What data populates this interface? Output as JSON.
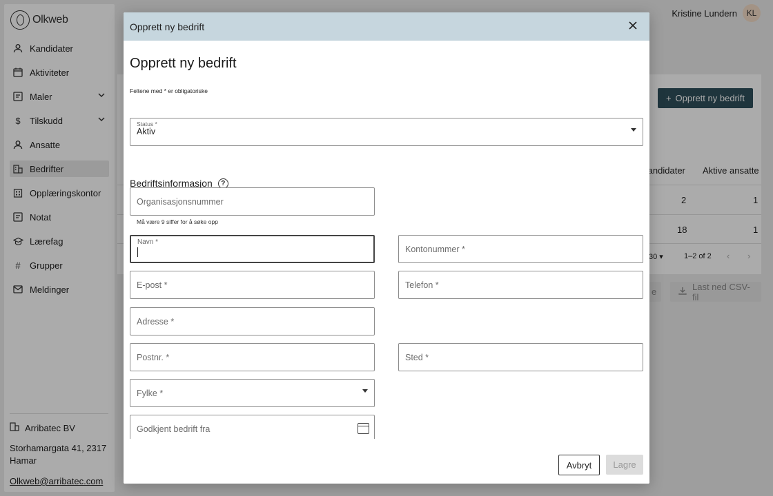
{
  "app": {
    "logo_text": "Olkweb"
  },
  "user": {
    "name": "Kristine Lundern",
    "initials": "KL"
  },
  "sidebar": {
    "items": [
      {
        "label": "Kandidater",
        "icon": "person-icon"
      },
      {
        "label": "Aktiviteter",
        "icon": "calendar-icon"
      },
      {
        "label": "Maler",
        "icon": "template-icon",
        "expandable": true
      },
      {
        "label": "Tilskudd",
        "icon": "dollar-icon",
        "expandable": true
      },
      {
        "label": "Ansatte",
        "icon": "person-icon"
      },
      {
        "label": "Bedrifter",
        "icon": "building-icon",
        "active": true
      },
      {
        "label": "Opplæringskontor",
        "icon": "office-icon"
      },
      {
        "label": "Notat",
        "icon": "note-icon"
      },
      {
        "label": "Lærefag",
        "icon": "school-icon"
      },
      {
        "label": "Grupper",
        "icon": "hash-icon"
      },
      {
        "label": "Meldinger",
        "icon": "mail-icon"
      }
    ],
    "company": {
      "name": "Arribatec BV",
      "address": "Storhamargata 41, 2317 Hamar",
      "email": "Olkweb@arribatec.com"
    }
  },
  "background": {
    "create_button": "Opprett ny bedrift",
    "columns": [
      "Kandidater",
      "Aktive ansatte"
    ],
    "rows": [
      [
        "2",
        "1"
      ],
      [
        "18",
        "1"
      ]
    ],
    "rows_per_page": "30",
    "pagination": "1–2 of 2",
    "export_button_partial": "e",
    "csv_button": "Last ned CSV-fil"
  },
  "dialog": {
    "header": "Opprett ny bedrift",
    "title": "Opprett ny bedrift",
    "required_note": "Feltene med * er obligatoriske",
    "status": {
      "label": "Status *",
      "value": "Aktiv"
    },
    "section_title": "Bedriftsinformasjon",
    "fields": {
      "orgnr": {
        "placeholder": "Organisasjonsnummer",
        "helper": "Må være 9 siffer for å søke opp"
      },
      "navn": {
        "label": "Navn *"
      },
      "kontonummer": {
        "placeholder": "Kontonummer *"
      },
      "epost": {
        "placeholder": "E-post *"
      },
      "telefon": {
        "placeholder": "Telefon *"
      },
      "adresse": {
        "placeholder": "Adresse *"
      },
      "postnr": {
        "placeholder": "Postnr. *"
      },
      "sted": {
        "placeholder": "Sted *"
      },
      "fylke": {
        "placeholder": "Fylke *"
      },
      "godkjent": {
        "placeholder": "Godkjent bedrift fra"
      }
    },
    "cancel_button": "Avbryt",
    "save_button": "Lagre"
  }
}
